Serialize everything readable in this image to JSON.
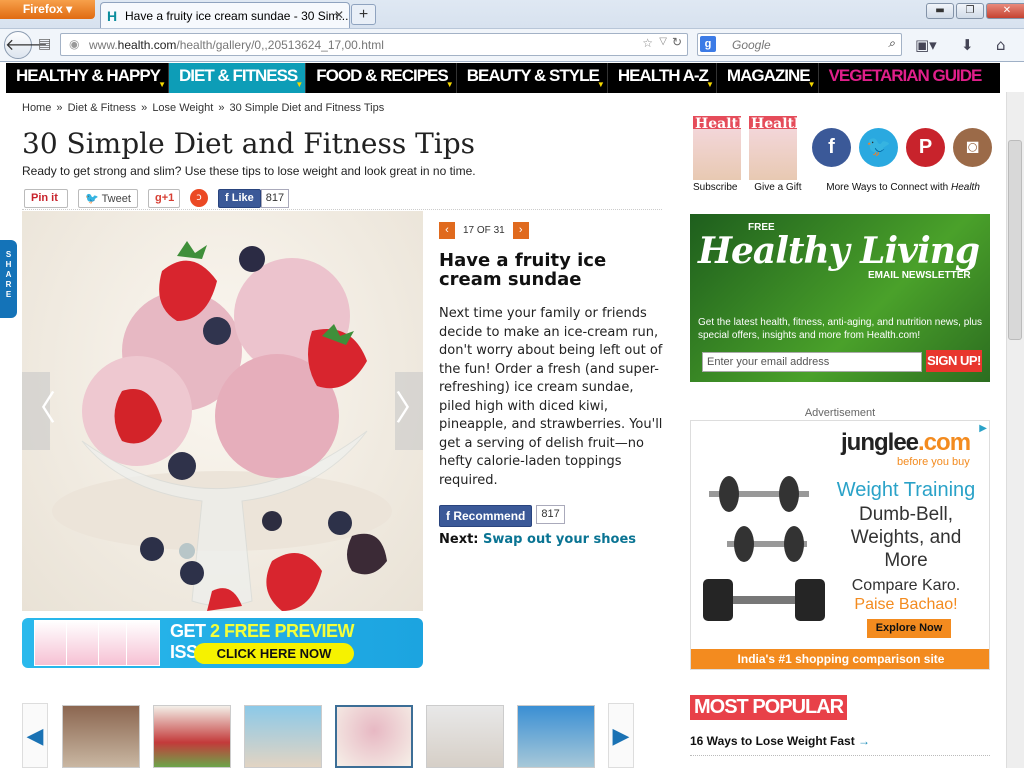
{
  "browser": {
    "app_button": "Firefox",
    "tab_title": "Have a fruity ice cream sundae - 30 Sim...",
    "tab_favicon": "H",
    "url_prefix": "www.",
    "url_domain": "health.com",
    "url_path": "/health/gallery/0,,20513624_17,00.html",
    "search_placeholder": "Google"
  },
  "nav": {
    "items": [
      {
        "label": "HEALTHY & HAPPY"
      },
      {
        "label": "DIET & FITNESS"
      },
      {
        "label": "FOOD & RECIPES"
      },
      {
        "label": "BEAUTY & STYLE"
      },
      {
        "label": "HEALTH A-Z"
      },
      {
        "label": "MAGAZINE"
      },
      {
        "label": "VEGETARIAN GUIDE"
      }
    ]
  },
  "share_tab": "SHARE",
  "breadcrumb": {
    "home": "Home",
    "sep": "»",
    "diet": "Diet & Fitness",
    "lose": "Lose Weight",
    "current": "30 Simple Diet and Fitness Tips"
  },
  "article": {
    "title": "30 Simple Diet and Fitness Tips",
    "subtitle": "Ready to get strong and slim? Use these tips to lose weight and look great in no time.",
    "pin": "Pin it",
    "tweet": "Tweet",
    "gplus": "g+1",
    "like": "Like",
    "like_count": "817"
  },
  "slide": {
    "counter": "17 OF 31",
    "title": "Have a fruity ice cream sundae",
    "body": "Next time your family or friends decide to make an ice-cream run, don't worry about being left out of the fun! Order a fresh (and super-refreshing) ice cream sundae, piled high with diced kiwi, pineapple, and strawberries. You'll get a serving of delish fruit—no hefty calorie-laden toppings required.",
    "recommend": "Recommend",
    "recommend_count": "817",
    "next_label": "Next:",
    "next_link": "Swap out your shoes"
  },
  "promo": {
    "get": "GET ",
    "free": "2 FREE PREVIEW",
    "issues": " ISSUES!",
    "cta": "CLICK HERE NOW"
  },
  "sidebar": {
    "subscribe": "Subscribe",
    "gift": "Give a Gift",
    "more_ways": "More Ways to Connect with ",
    "more_ways_brand": "Health",
    "mag_brand": "Health",
    "newsletter": {
      "free": "FREE",
      "title": "Healthy Living",
      "sub": "EMAIL NEWSLETTER",
      "desc": "Get the latest health, fitness, anti-aging, and nutrition news, plus special offers, insights and more from Health.com!",
      "placeholder": "Enter your email address",
      "signup": "SIGN UP!"
    },
    "ad_label": "Advertisement",
    "ad": {
      "logo_a": "junglee",
      "logo_b": ".com",
      "tagline": "before you buy",
      "line1": "Weight Training",
      "line2": "Dumb-Bell, Weights, and More",
      "line3": "Compare Karo.",
      "line4": "Paise Bachao!",
      "button": "Explore Now",
      "footer": "India's #1 shopping comparison site"
    },
    "most_popular": "MOST POPULAR",
    "popular_item": "16 Ways to Lose Weight Fast"
  },
  "colors": {
    "nav_active": "#0d9db7",
    "accent_orange": "#e06a1e",
    "facebook": "#3b5998",
    "vegetarian": "#e01f8a"
  }
}
